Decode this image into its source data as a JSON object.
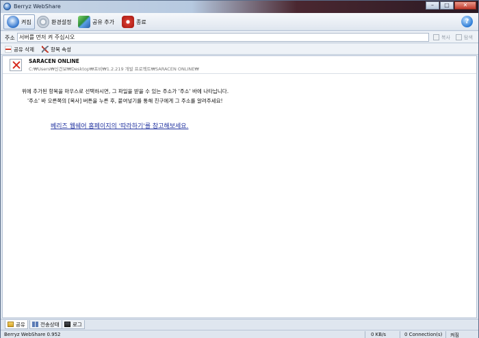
{
  "window": {
    "title": "Berryz WebShare"
  },
  "toolbar": {
    "items": [
      {
        "label": "켜짐",
        "icon": "network-icon"
      },
      {
        "label": "환경설정",
        "icon": "gear-icon"
      },
      {
        "label": "공유 추가",
        "icon": "share-add-icon"
      },
      {
        "label": "종료",
        "icon": "power-icon"
      }
    ]
  },
  "address": {
    "label": "주소",
    "value": "서버를 먼저 켜 주십시오",
    "copy_label": "복사",
    "search_label": "탐색"
  },
  "actions": {
    "remove_label": "공유 삭제",
    "properties_label": "항목 속성"
  },
  "item": {
    "name": "SARACEN ONLINE",
    "path": "C:₩Users₩신건보₩Desktop₩프비₩1.2.219 개발 프로젝트₩SARACEN ONLINE₩"
  },
  "content": {
    "desc1": "위에 추가된 항목을 마우스로 선택하시면, 그 파일을 받을 수 있는 주소가 '주소' 바에 나타납니다.",
    "desc2": "'주소' 바 오른쪽의 [복사] 버튼을 누른 후, 붙여넣기를 통해 친구에게 그 주소를 알려주세요!",
    "link": "베리즈 웹쉐어 홈페이지의 '따라하기'를 참고해보세요."
  },
  "tabs": [
    {
      "label": "공유",
      "icon": "folder-icon"
    },
    {
      "label": "전송상태",
      "icon": "transfer-icon"
    },
    {
      "label": "로그",
      "icon": "log-icon"
    }
  ],
  "status": {
    "version": "Berryz WebShare 0.952",
    "speed": "0 KB/s",
    "connections": "0 Connection(s)",
    "state": "켜짐"
  },
  "colors": {
    "link": "#1d2f9e",
    "accent": "#3a7bd0",
    "close": "#c0392b"
  }
}
